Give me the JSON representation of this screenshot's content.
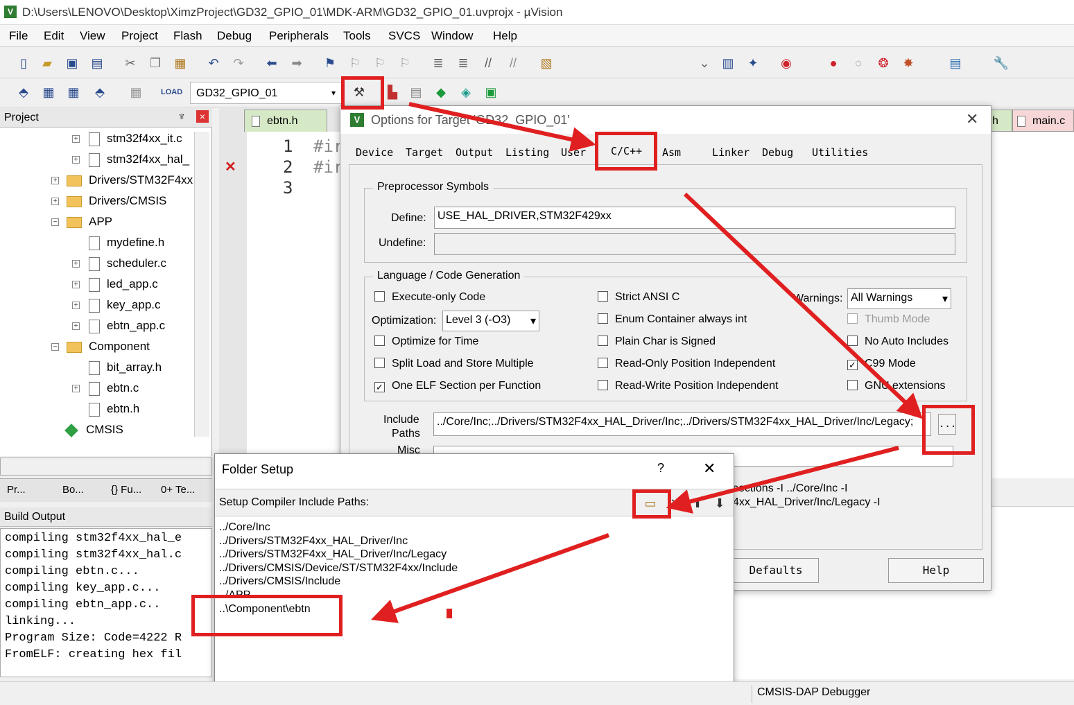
{
  "window": {
    "title": "D:\\Users\\LENOVO\\Desktop\\XimzProject\\GD32_GPIO_01\\MDK-ARM\\GD32_GPIO_01.uvprojx - µVision",
    "logo": "V"
  },
  "menu": [
    "File",
    "Edit",
    "View",
    "Project",
    "Flash",
    "Debug",
    "Peripherals",
    "Tools",
    "SVCS",
    "Window",
    "Help"
  ],
  "toolbar2": {
    "target": "GD32_GPIO_01"
  },
  "project": {
    "title": "Project",
    "pin": "♆",
    "close": "×",
    "tree": [
      "stm32f4xx_it.c",
      "stm32f4xx_hal_",
      "Drivers/STM32F4xx",
      "Drivers/CMSIS",
      "APP",
      "mydefine.h",
      "scheduler.c",
      "led_app.c",
      "key_app.c",
      "ebtn_app.c",
      "Component",
      "bit_array.h",
      "ebtn.c",
      "ebtn.h",
      "CMSIS"
    ]
  },
  "editor": {
    "tab": "ebtn.h",
    "lines": [
      "1",
      "2",
      "3"
    ],
    "code": [
      "#ir",
      "#ir"
    ],
    "right_tabs": [
      "h",
      "main.c"
    ]
  },
  "bottom_tabs": [
    "Pr...",
    "Bo...",
    "{} Fu...",
    "0+ Te..."
  ],
  "build": {
    "title": "Build Output",
    "lines": [
      "compiling stm32f4xx_hal_e",
      "compiling stm32f4xx_hal.c",
      "compiling ebtn.c...",
      "compiling key_app.c...",
      "compiling ebtn_app.c..",
      "linking...",
      "Program Size: Code=4222 R",
      "FromELF: creating hex fil"
    ]
  },
  "options": {
    "title": "Options for Target 'GD32_GPIO_01'",
    "close": "✕",
    "tabs": [
      "Device",
      "Target",
      "Output",
      "Listing",
      "User",
      "C/C++",
      "Asm",
      "Linker",
      "Debug",
      "Utilities"
    ],
    "pre": {
      "legend": "Preprocessor Symbols",
      "define_label": "Define:",
      "define_value": "USE_HAL_DRIVER,STM32F429xx",
      "undefine_label": "Undefine:"
    },
    "lang": {
      "legend": "Language / Code Generation",
      "opt_label": "Optimization:",
      "opt_value": "Level 3 (-O3)",
      "warn_label": "Warnings:",
      "warn_value": "All Warnings",
      "c1": [
        "Execute-only Code",
        "Optimize for Time",
        "Split Load and Store Multiple",
        "One ELF Section per Function"
      ],
      "c2": [
        "Strict ANSI C",
        "Enum Container always int",
        "Plain Char is Signed",
        "Read-Only Position Independent",
        "Read-Write Position Independent"
      ],
      "c3": [
        "Thumb Mode",
        "No Auto Includes",
        "C99 Mode",
        "GNU extensions"
      ]
    },
    "include_label1": "Include",
    "include_label2": "Paths",
    "include_value": "../Core/Inc;../Drivers/STM32F4xx_HAL_Driver/Inc;../Drivers/STM32F4xx_HAL_Driver/Inc/Legacy;",
    "browse": "...",
    "misc": "Misc",
    "controls1": "sections -I ../Core/Inc -I",
    "controls2": "4xx_HAL_Driver/Inc/Legacy -I",
    "defaults": "Defaults",
    "help": "Help"
  },
  "folder": {
    "title": "Folder Setup",
    "help": "?",
    "close": "✕",
    "label": "Setup Compiler Include Paths:",
    "paths": [
      "../Core/Inc",
      "../Drivers/STM32F4xx_HAL_Driver/Inc",
      "../Drivers/STM32F4xx_HAL_Driver/Inc/Legacy",
      "../Drivers/CMSIS/Device/ST/STM32F4xx/Include",
      "../Drivers/CMSIS/Include",
      "../APP",
      "..\\Component\\ebtn"
    ]
  },
  "status": {
    "debugger": "CMSIS-DAP Debugger"
  },
  "colors": {
    "highlight": "#e02020",
    "folder": "#f3c35b",
    "cmsis": "#2ea043"
  }
}
